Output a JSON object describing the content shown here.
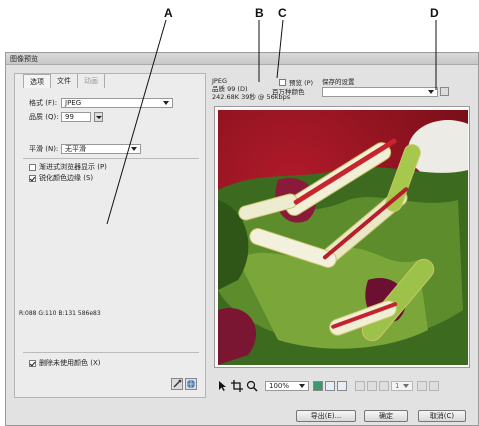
{
  "callouts": [
    "A",
    "B",
    "C",
    "D"
  ],
  "window": {
    "title": "图像预览"
  },
  "tabs": [
    {
      "label": "选项"
    },
    {
      "label": "文件"
    },
    {
      "label": "动画"
    }
  ],
  "options": {
    "format_label": "格式 (F):",
    "format_value": "JPEG",
    "quality_label": "品质 (Q):",
    "quality_value": "99",
    "smoothing_label": "平滑 (N):",
    "smoothing_value": "无平滑",
    "progressive_label": "渐进式浏览器显示 (P)",
    "optimize_label": "锐化颜色边缘 (S)",
    "color_readout": "R:088 G:110 B:131 586e83",
    "remove_unused_label": "删除未使用颜色 (X)"
  },
  "preview_info": {
    "format": "JPEG",
    "quality": "品质 99 (D)",
    "size": "242.68K 39秒 @ 56kbps",
    "preview_label": "预览 (P)",
    "colors": "百万种颜色",
    "saved_settings_label": "保存的设置"
  },
  "toolbar": {
    "zoom": "100%",
    "frame": "1"
  },
  "buttons": {
    "export": "导出(E)...",
    "ok": "确定",
    "cancel": "取消(C)"
  }
}
